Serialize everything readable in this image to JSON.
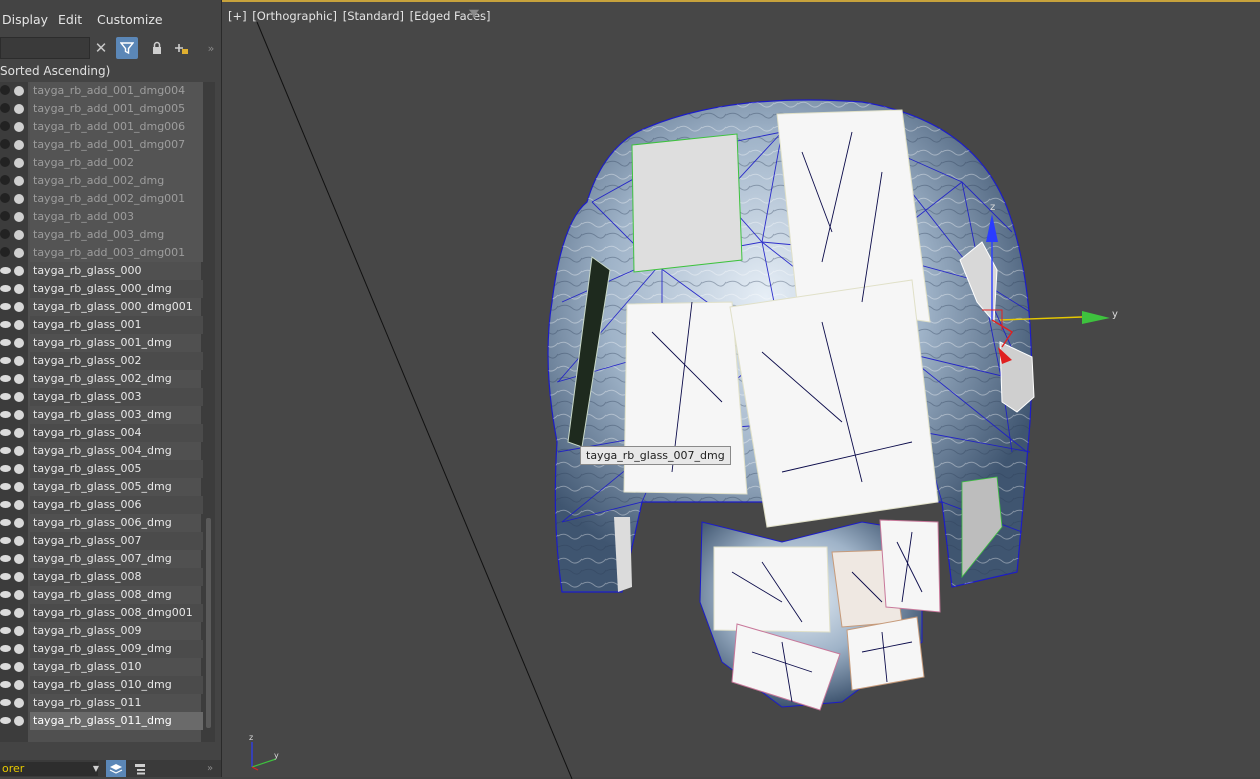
{
  "menu": {
    "display": "Display",
    "edit": "Edit",
    "customize": "Customize"
  },
  "toolbar": {
    "more": "»"
  },
  "list_header": "Sorted Ascending)",
  "objects": [
    {
      "name": "tayga_rb_add_001_dmg004",
      "visible": false
    },
    {
      "name": "tayga_rb_add_001_dmg005",
      "visible": false
    },
    {
      "name": "tayga_rb_add_001_dmg006",
      "visible": false
    },
    {
      "name": "tayga_rb_add_001_dmg007",
      "visible": false
    },
    {
      "name": "tayga_rb_add_002",
      "visible": false
    },
    {
      "name": "tayga_rb_add_002_dmg",
      "visible": false
    },
    {
      "name": "tayga_rb_add_002_dmg001",
      "visible": false
    },
    {
      "name": "tayga_rb_add_003",
      "visible": false
    },
    {
      "name": "tayga_rb_add_003_dmg",
      "visible": false
    },
    {
      "name": "tayga_rb_add_003_dmg001",
      "visible": false
    },
    {
      "name": "tayga_rb_glass_000",
      "visible": true
    },
    {
      "name": "tayga_rb_glass_000_dmg",
      "visible": true
    },
    {
      "name": "tayga_rb_glass_000_dmg001",
      "visible": true
    },
    {
      "name": "tayga_rb_glass_001",
      "visible": true
    },
    {
      "name": "tayga_rb_glass_001_dmg",
      "visible": true
    },
    {
      "name": "tayga_rb_glass_002",
      "visible": true
    },
    {
      "name": "tayga_rb_glass_002_dmg",
      "visible": true
    },
    {
      "name": "tayga_rb_glass_003",
      "visible": true
    },
    {
      "name": "tayga_rb_glass_003_dmg",
      "visible": true
    },
    {
      "name": "tayga_rb_glass_004",
      "visible": true
    },
    {
      "name": "tayga_rb_glass_004_dmg",
      "visible": true
    },
    {
      "name": "tayga_rb_glass_005",
      "visible": true
    },
    {
      "name": "tayga_rb_glass_005_dmg",
      "visible": true
    },
    {
      "name": "tayga_rb_glass_006",
      "visible": true
    },
    {
      "name": "tayga_rb_glass_006_dmg",
      "visible": true
    },
    {
      "name": "tayga_rb_glass_007",
      "visible": true
    },
    {
      "name": "tayga_rb_glass_007_dmg",
      "visible": true
    },
    {
      "name": "tayga_rb_glass_008",
      "visible": true
    },
    {
      "name": "tayga_rb_glass_008_dmg",
      "visible": true
    },
    {
      "name": "tayga_rb_glass_008_dmg001",
      "visible": true
    },
    {
      "name": "tayga_rb_glass_009",
      "visible": true
    },
    {
      "name": "tayga_rb_glass_009_dmg",
      "visible": true
    },
    {
      "name": "tayga_rb_glass_010",
      "visible": true
    },
    {
      "name": "tayga_rb_glass_010_dmg",
      "visible": true
    },
    {
      "name": "tayga_rb_glass_011",
      "visible": true
    },
    {
      "name": "tayga_rb_glass_011_dmg",
      "visible": true,
      "selected": true
    }
  ],
  "bottom_bar": {
    "explorer_name": "orer"
  },
  "viewport": {
    "labels": [
      "[+]",
      "[Orthographic]",
      "[Standard]",
      "[Edged Faces]"
    ],
    "tooltip": "tayga_rb_glass_007_dmg",
    "gizmo_y_label": "y",
    "gizmo_z_label": "z",
    "axis_tripod_z": "z",
    "axis_tripod_y": "y"
  },
  "colors": {
    "accent": "#5b87b7",
    "viewport_border": "#c7a23c",
    "wire": "#1c1cc8",
    "gizmo_y": "#3ec23e",
    "gizmo_z": "#2a3cff",
    "gizmo_x": "#e02020"
  }
}
